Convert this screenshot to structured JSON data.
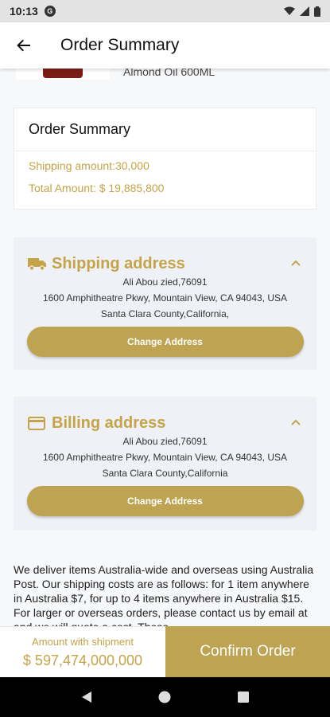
{
  "status_bar": {
    "time": "10:13",
    "g_badge": "G"
  },
  "appbar": {
    "title": "Order Summary"
  },
  "product": {
    "name": "Almond Oil 600ML"
  },
  "summary": {
    "title": "Order Summary",
    "shipping": "Shipping amount:30,000",
    "total": "Total Amount: $ 19,885,800"
  },
  "shipping_address": {
    "title": "Shipping address",
    "lines": [
      "Ali Abou zied,76091",
      "1600 Amphitheatre Pkwy, Mountain View, CA 94043, USA",
      "Santa Clara County,California,"
    ],
    "button": "Change Address"
  },
  "billing_address": {
    "title": "Billing address",
    "lines": [
      "Ali Abou zied,76091",
      "1600 Amphitheatre Pkwy, Mountain View, CA 94043, USA",
      "Santa Clara County,California"
    ],
    "button": "Change Address"
  },
  "policy_text": "We deliver items Australia-wide and overseas using Australia Post. Our shipping costs are as follows: for 1 item anywhere in Australia $7, for up to 4 items anywhere in Australia $15. For larger or overseas orders, please contact us by email at and we will quote a cost. These",
  "bottom": {
    "amount_label": "Amount with shipment",
    "amount_value": "$ 597,474,000,000",
    "confirm": "Confirm Order"
  },
  "colors": {
    "accent": "#bda352",
    "accent_text": "#c5a348",
    "card_bg": "#eef1f5"
  },
  "icons": [
    "back-arrow-icon",
    "truck-icon",
    "credit-card-icon",
    "chevron-up-icon",
    "wifi-icon",
    "signal-icon",
    "battery-icon",
    "nav-back-icon",
    "nav-home-icon",
    "nav-recents-icon"
  ]
}
